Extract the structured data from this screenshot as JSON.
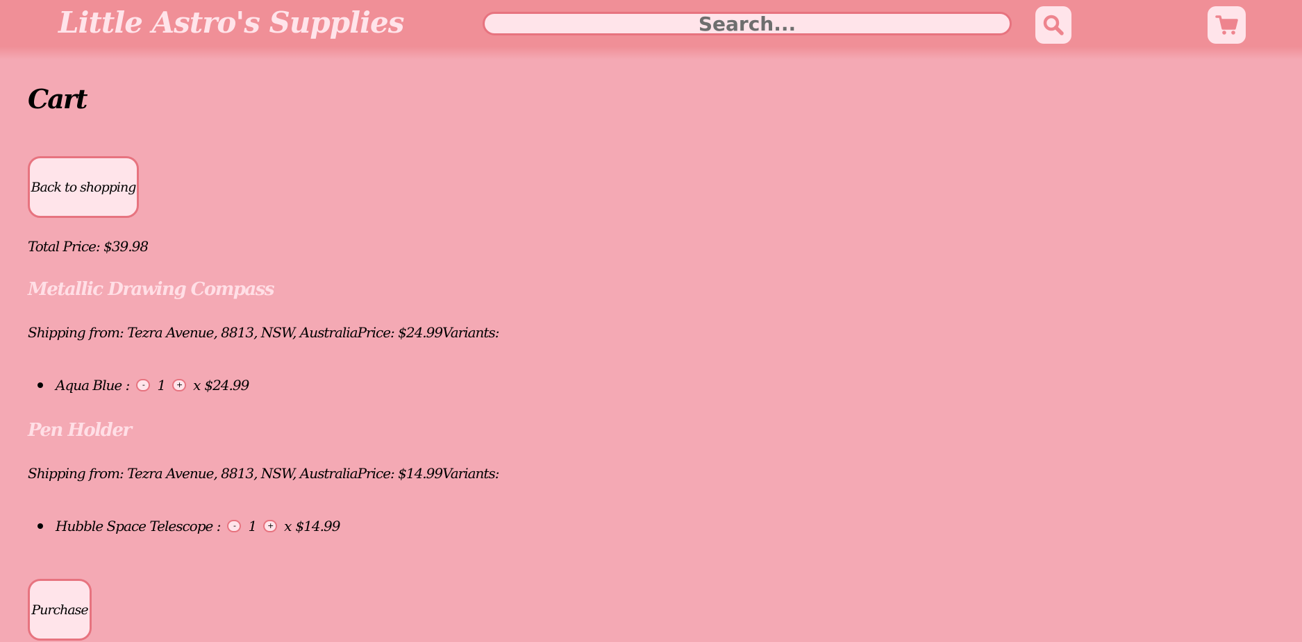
{
  "header": {
    "brand": "Little Astro's Supplies",
    "search_placeholder": "Search..."
  },
  "page": {
    "title": "Cart",
    "back_label": "Back to shopping",
    "total_label": "Total Price:",
    "total_value": "$39.98",
    "purchase_label": "Purchase"
  },
  "products": [
    {
      "name": "Metallic Drawing Compass",
      "details": "Shipping from: Tezra Avenue, 8813, NSW, AustraliaPrice: $24.99Variants:",
      "variant": {
        "label": "Aqua Blue :",
        "minus": "-",
        "qty": "1",
        "plus": "+",
        "times": "x",
        "price": "$24.99"
      }
    },
    {
      "name": "Pen Holder",
      "details": "Shipping from: Tezra Avenue, 8813, NSW, AustraliaPrice: $14.99Variants:",
      "variant": {
        "label": "Hubble Space Telescope :",
        "minus": "-",
        "qty": "1",
        "plus": "+",
        "times": "x",
        "price": "$14.99"
      }
    }
  ],
  "icons": {
    "search": "search-icon",
    "cart": "shopping-cart-icon"
  },
  "colors": {
    "background": "#f4a9b4",
    "header": "#f08f97",
    "accent_border": "#e7737f",
    "button_fill": "#ffe4ea",
    "product_name": "#ffdfe6"
  }
}
